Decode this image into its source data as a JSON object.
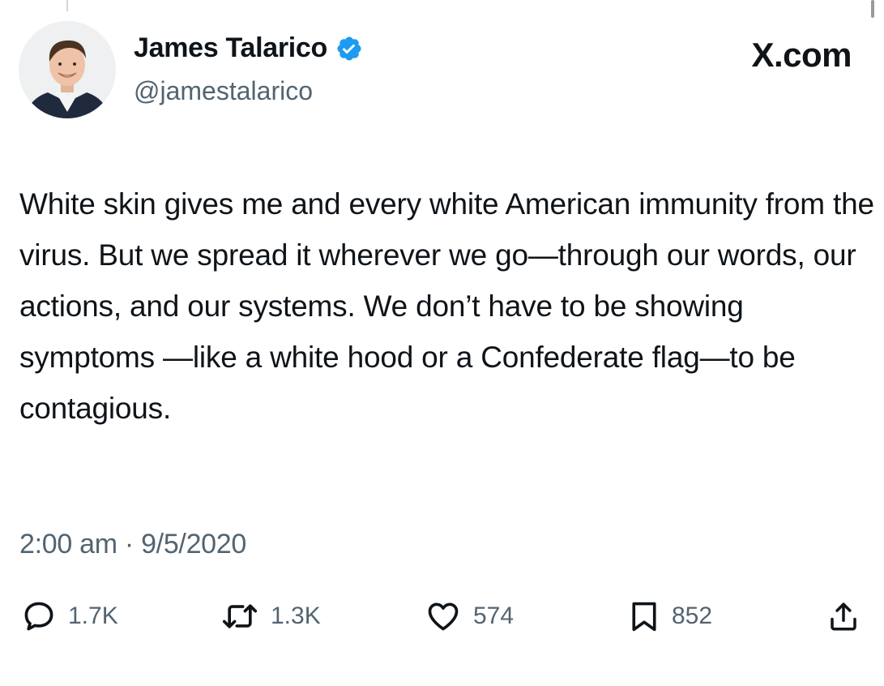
{
  "brand": {
    "label": "X.com"
  },
  "author": {
    "display_name": "James Talarico",
    "handle": "@jamestalarico",
    "verified": true
  },
  "tweet": {
    "text": "White skin gives me and every white American immunity from the virus. But we spread it wherever we go—through our words, our actions, and our systems. We don’t have to be showing symptoms —like a white hood or a Confederate flag—to be contagious.",
    "timestamp": "2:00 am · 9/5/2020"
  },
  "actions": {
    "replies": "1.7K",
    "reposts": "1.3K",
    "likes": "574",
    "bookmarks": "852"
  },
  "icons": {
    "reply": "speech-bubble-icon",
    "repost": "repost-arrows-icon",
    "like": "heart-icon",
    "bookmark": "bookmark-icon",
    "share": "share-upload-icon",
    "verified": "verified-badge-icon"
  },
  "colors": {
    "verified_blue": "#1d9bf0",
    "text_primary": "#0f1419",
    "text_secondary": "#536471"
  }
}
